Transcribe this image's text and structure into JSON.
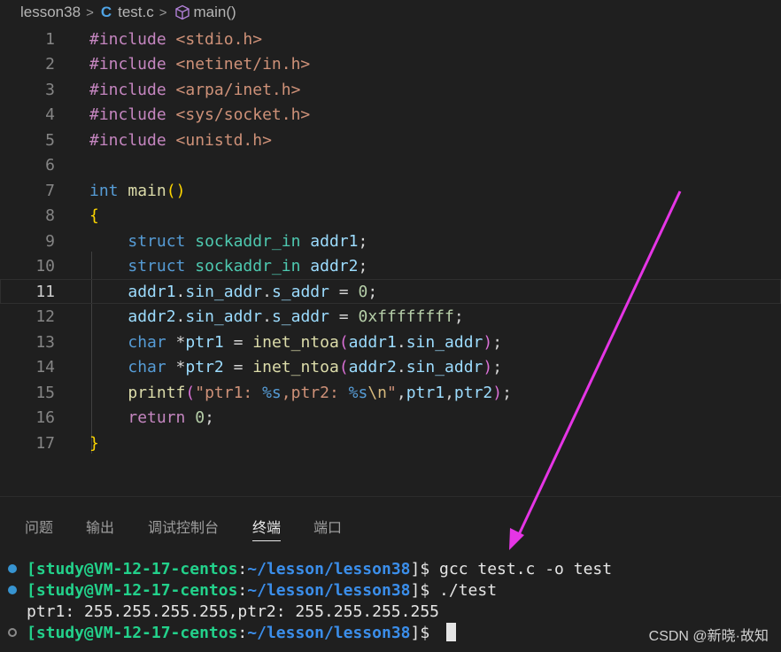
{
  "breadcrumb": {
    "folder": "lesson38",
    "file_icon": "C",
    "file": "test.c",
    "symbol": "main()"
  },
  "editor": {
    "current_line": 11,
    "lines": [
      {
        "n": "1"
      },
      {
        "n": "2"
      },
      {
        "n": "3"
      },
      {
        "n": "4"
      },
      {
        "n": "5"
      },
      {
        "n": "6"
      },
      {
        "n": "7"
      },
      {
        "n": "8"
      },
      {
        "n": "9"
      },
      {
        "n": "10"
      },
      {
        "n": "11"
      },
      {
        "n": "12"
      },
      {
        "n": "13"
      },
      {
        "n": "14"
      },
      {
        "n": "15"
      },
      {
        "n": "16"
      },
      {
        "n": "17"
      }
    ],
    "tokens": {
      "include": "#include",
      "h1": "<stdio.h>",
      "h2": "<netinet/in.h>",
      "h3": "<arpa/inet.h>",
      "h4": "<sys/socket.h>",
      "h5": "<unistd.h>",
      "int": "int",
      "main": "main",
      "lparen": "(",
      "rparen": ")",
      "lbrace": "{",
      "rbrace": "}",
      "struct": "struct",
      "sockaddr_in": "sockaddr_in",
      "addr1": "addr1",
      "addr2": "addr2",
      "semi": ";",
      "dot": ".",
      "sin_addr": "sin_addr",
      "s_addr": "s_addr",
      "eq": " = ",
      "zero": "0",
      "hex": "0xffffffff",
      "char": "char",
      "star": " *",
      "ptr1": "ptr1",
      "ptr2": "ptr2",
      "inet_ntoa": "inet_ntoa",
      "printf": "printf",
      "fmt_a": "\"ptr1: ",
      "fmt_s": "%s",
      "fmt_b": ",ptr2: ",
      "fmt_esc": "\\n",
      "fmt_q": "\"",
      "comma": ",",
      "return": "return"
    }
  },
  "panel": {
    "tabs": [
      "问题",
      "输出",
      "调试控制台",
      "终端",
      "端口"
    ],
    "active_tab": "终端"
  },
  "terminal": {
    "user_host": "[study@VM-12-17-centos",
    "colon": ":",
    "path": "~/lesson/lesson38",
    "prompt_end": "]$ ",
    "cmd1": "gcc test.c -o test",
    "cmd2": "./test",
    "output": "ptr1: 255.255.255.255,ptr2: 255.255.255.255"
  },
  "watermark": "CSDN @新晓·故知",
  "colors": {
    "background": "#1f1f1f",
    "keyword": "#c586c0",
    "string": "#ce9178",
    "prompt_green": "#23d18b",
    "prompt_blue": "#3b8eea",
    "annotation_arrow": "#e535e5"
  },
  "icons": {
    "file_type": "c-language-icon",
    "symbol": "cube-method-icon",
    "chevron": "chevron-right-icon"
  }
}
